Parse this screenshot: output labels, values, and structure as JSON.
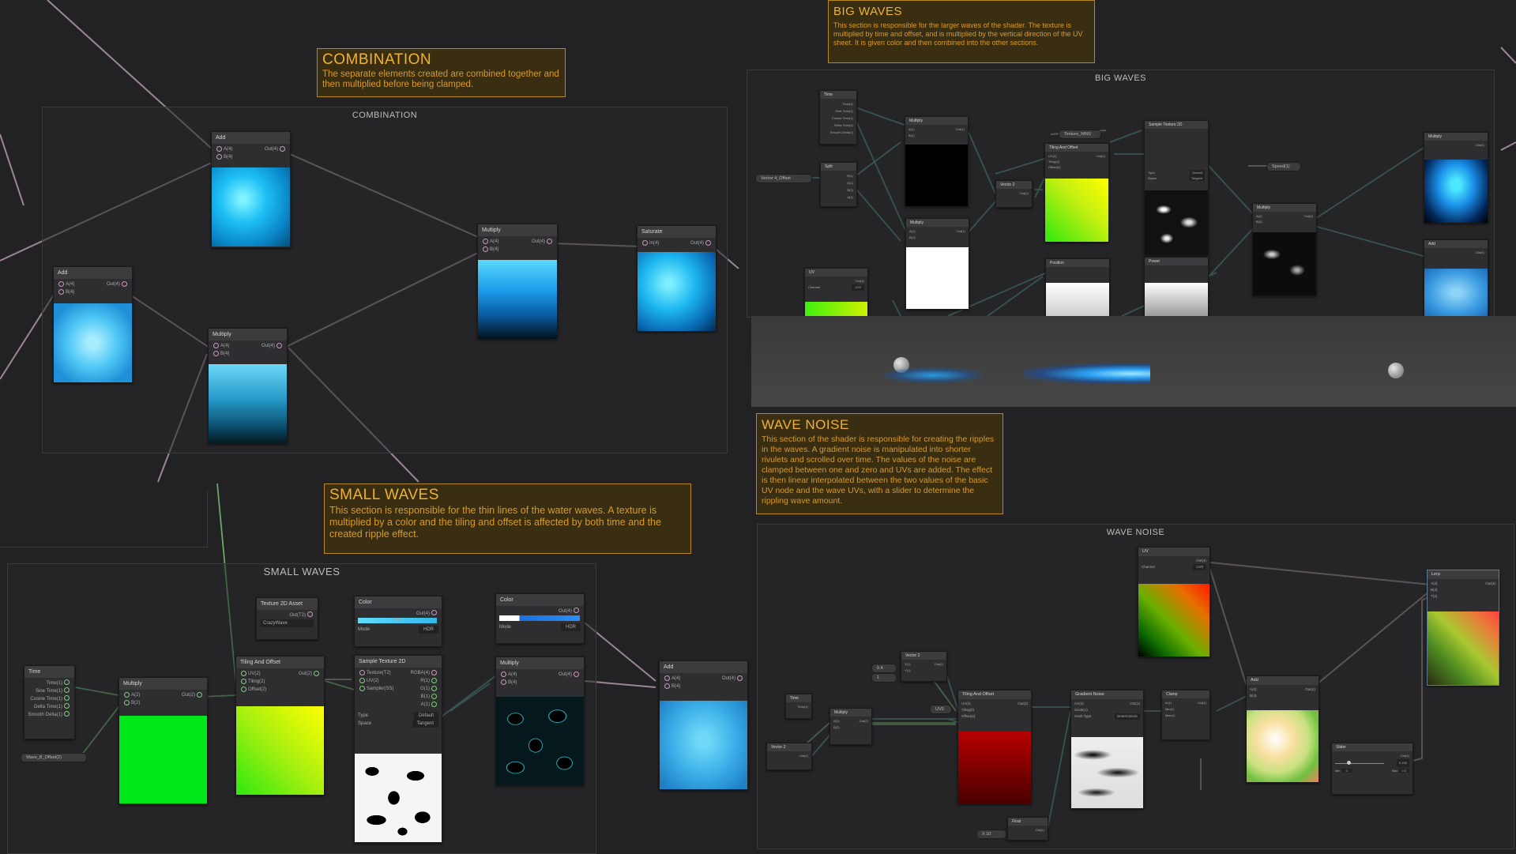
{
  "sticky_notes": {
    "combination": {
      "title": "COMBINATION",
      "body": "The separate elements created are combined together and then multiplied before being clamped."
    },
    "big_waves": {
      "title": "BIG WAVES",
      "body": "This section is responsible for the larger waves of the shader. The texture is multiplied by time and offset, and is multiplied by the vertical direction of the UV sheet. It is given color and then combined into the other sections."
    },
    "small_waves": {
      "title": "SMALL WAVES",
      "body": "This section is responsible for the thin lines of the water waves. A texture is multiplied by a color and the tiling and offset is affected by both time and the created ripple effect."
    },
    "wave_noise": {
      "title": "WAVE NOISE",
      "body": "This section of the shader is responsible for creating the ripples in the waves. A gradient noise is manipulated into shorter rivulets and scrolled over time. The values of the noise are clamped between one and zero and UVs are added. The effect is then linear interpolated between the two values of the basic UV node and the wave UVs, with a slider to determine the rippling wave amount."
    }
  },
  "groups": {
    "combination": "COMBINATION",
    "big_waves": "BIG WAVES",
    "small_waves": "SMALL WAVES",
    "wave_noise": "WAVE NOISE"
  },
  "nodes": {
    "comb_add_top": {
      "title": "Add",
      "in": [
        "A(4)",
        "B(4)"
      ],
      "out": "Out(4)"
    },
    "comb_add_left": {
      "title": "Add",
      "in": [
        "A(4)",
        "B(4)"
      ],
      "out": "Out(4)"
    },
    "comb_multiply_low": {
      "title": "Multiply",
      "in": [
        "A(4)",
        "B(4)"
      ],
      "out": "Out(4)"
    },
    "comb_multiply_mid": {
      "title": "Multiply",
      "in": [
        "A(4)",
        "B(4)"
      ],
      "out": "Out(4)"
    },
    "comb_saturate": {
      "title": "Saturate",
      "in": [
        "In(4)"
      ],
      "out": "Out(4)"
    },
    "sw_time": {
      "title": "Time",
      "out": [
        "Time(1)",
        "Sine Time(1)",
        "Cosine Time(1)",
        "Delta Time(1)",
        "Smooth Delta(1)"
      ]
    },
    "sw_multiply": {
      "title": "Multiply",
      "in": [
        "A(2)",
        "B(2)"
      ],
      "out": "Out(2)"
    },
    "sw_tiling": {
      "title": "Tiling And Offset",
      "in": [
        "UV(2)",
        "Tiling(2)",
        "Offset(2)"
      ],
      "out": "Out(2)"
    },
    "sw_texture_asset": {
      "title": "Texture 2D Asset",
      "out": "Out(T2)",
      "value": "CrazyWave"
    },
    "sw_color": {
      "title": "Color",
      "out": "Out(4)",
      "mode_label": "Mode",
      "mode": "HDR",
      "hdr": "HDR"
    },
    "sw_sample": {
      "title": "Sample Texture 2D",
      "in": [
        "Texture(T2)",
        "UV(2)",
        "Sampler(SS)"
      ],
      "out": [
        "RGBA(4)",
        "R(1)",
        "G(1)",
        "B(1)",
        "A(1)"
      ],
      "type_label": "Type",
      "type": "Default",
      "space_label": "Space",
      "space": "Tangent"
    },
    "sw_color2": {
      "title": "Color",
      "out": "Out(4)",
      "mode_label": "Mode",
      "mode": "HDR"
    },
    "sw_multiply2": {
      "title": "Multiply",
      "in": [
        "A(4)",
        "B(4)"
      ],
      "out": "Out(4)"
    },
    "sw_add": {
      "title": "Add",
      "in": [
        "A(4)",
        "B(4)"
      ],
      "out": "Out(4)"
    },
    "sw_wave_prop": "Wave_B_Offset(2)",
    "bw_time": {
      "title": "Time",
      "out": [
        "Time(1)",
        "Sine Time(1)",
        "Cosine Time(1)",
        "Delta Time(1)",
        "Smooth Delta(1)"
      ]
    },
    "bw_split": {
      "title": "Split",
      "out": [
        "R(1)",
        "G(1)",
        "B(1)",
        "A(1)"
      ]
    },
    "bw_multiply1": {
      "title": "Multiply",
      "in": [
        "A(1)",
        "B(1)"
      ],
      "out": "Out(1)"
    },
    "bw_multiply2": {
      "title": "Multiply",
      "in": [
        "A(1)",
        "B(1)"
      ],
      "out": "Out(1)"
    },
    "bw_uv": {
      "title": "UV",
      "out": "Out(4)",
      "channel_label": "Channel",
      "channel": "UV0"
    },
    "bw_tiling": {
      "title": "Tiling And Offset",
      "in": [
        "UV(2)",
        "Tiling(2)",
        "Offset(2)"
      ],
      "out": "Out(2)"
    },
    "bw_vector2": {
      "title": "Vector 2",
      "out": "Out(2)"
    },
    "bw_sample": {
      "title": "Sample Texture 2D",
      "type_label": "Type",
      "type": "Default",
      "space_label": "Space",
      "space": "Tangent"
    },
    "bw_multiply3": {
      "title": "Multiply",
      "in": [
        "A(4)",
        "B(4)"
      ],
      "out": "Out(4)"
    },
    "bw_preview_a": {
      "title": "Position"
    },
    "bw_preview_b": {
      "title": "Power"
    },
    "bw_final_top": {
      "title": "Multiply",
      "out": "Out(4)"
    },
    "bw_final_bot": {
      "title": "Add",
      "out": "Out(4)"
    },
    "bw_prop_left": "Vector 4_Offset",
    "bw_prop_tex": "Texture_WNS",
    "bw_prop_speed": "Speed(1)",
    "wn_time": {
      "title": "Time",
      "out": [
        "Time(1)"
      ]
    },
    "wn_vector2_bot": {
      "title": "Vector 2",
      "out": "Out(2)"
    },
    "wn_multiply": {
      "title": "Multiply",
      "in": [
        "A(2)",
        "B(2)"
      ],
      "out": "Out(2)"
    },
    "wn_vector2_top": {
      "title": "Vector 2",
      "in": [
        "X(1)",
        "Y(1)"
      ],
      "out": "Out(2)",
      "x": "0.4",
      "y": "1"
    },
    "wn_tiling": {
      "title": "Tiling And Offset",
      "in": [
        "UV(2)",
        "Tiling(2)",
        "Offset(2)"
      ],
      "out": "Out(2)"
    },
    "wn_gradient": {
      "title": "Gradient Noise",
      "in": [
        "UV(2)",
        "Scale(1)"
      ],
      "out": "Out(1)",
      "hash_label": "Hash Type",
      "hash": "Deterministic"
    },
    "wn_clamp": {
      "title": "Clamp",
      "in": [
        "In(1)",
        "Min(1)",
        "Max(1)"
      ],
      "out": "Out(1)"
    },
    "wn_uv": {
      "title": "UV",
      "out": "Out(4)",
      "channel_label": "Channel",
      "channel": "UV0"
    },
    "wn_add": {
      "title": "Add",
      "in": [
        "A(4)",
        "B(4)"
      ],
      "out": "Out(4)"
    },
    "wn_slider": {
      "title": "Slider",
      "out": "Out(1)",
      "value": "0.155",
      "min_label": "Min",
      "min": "0",
      "max_label": "Max",
      "max": "0.3"
    },
    "wn_lerp": {
      "title": "Lerp",
      "in": [
        "A(4)",
        "B(4)",
        "T(4)"
      ],
      "out": "Out(4)"
    },
    "wn_float": {
      "title": "Float",
      "out": "Out(1)",
      "x_label": "X",
      "value": "10"
    },
    "wn_uv0_pill": "UV0"
  },
  "colors": {
    "background": "#222224",
    "sticky_bg": "#3a2e12",
    "sticky_border": "#b8891c",
    "sticky_text": "#e0a828",
    "wire_pink": "#a08898",
    "wire_teal": "#4f8a84",
    "wire_green": "#6fb06f"
  }
}
